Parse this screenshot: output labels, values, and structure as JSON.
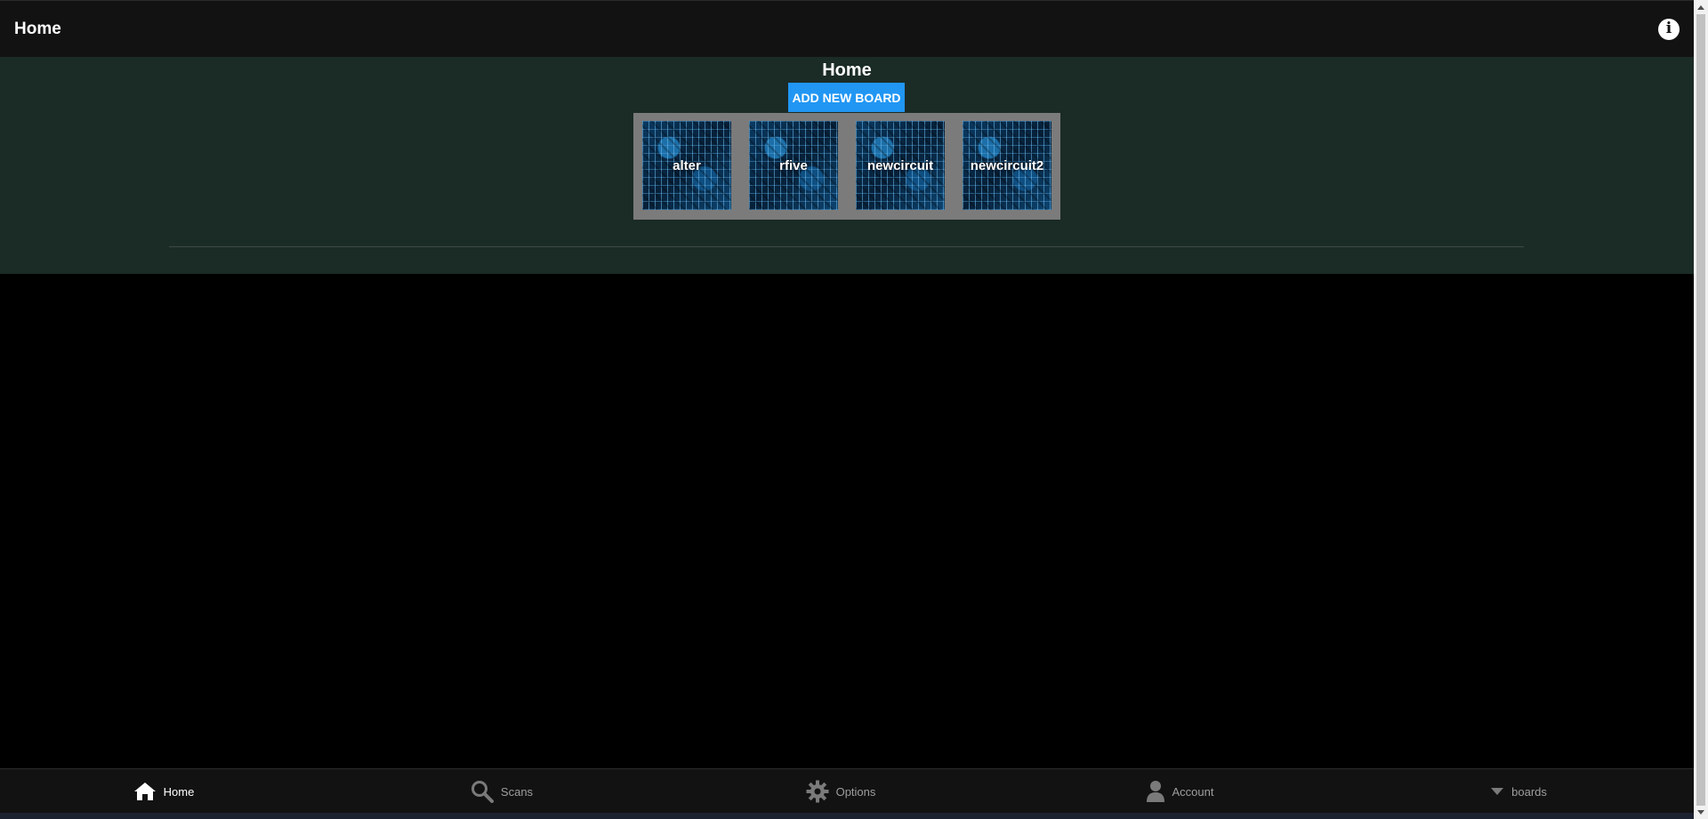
{
  "topbar": {
    "title": "Home",
    "info_icon": "info-circle-icon"
  },
  "main": {
    "title": "Home",
    "add_button_label": "ADD NEW BOARD",
    "boards": [
      {
        "name": "alter"
      },
      {
        "name": "rfive"
      },
      {
        "name": "newcircuit"
      },
      {
        "name": "newcircuit2"
      }
    ]
  },
  "bottom_nav": {
    "items": [
      {
        "label": "Home",
        "icon": "home-icon",
        "active": true
      },
      {
        "label": "Scans",
        "icon": "search-icon",
        "active": false
      },
      {
        "label": "Options",
        "icon": "gear-icon",
        "active": false
      },
      {
        "label": "Account",
        "icon": "user-icon",
        "active": false
      },
      {
        "label": "boards",
        "icon": "caret-down-icon",
        "active": false
      }
    ]
  },
  "colors": {
    "topbar_bg": "#121212",
    "main_bg": "#1b2b26",
    "accent": "#2196f3",
    "board_strip_bg": "#7b7b7b"
  }
}
